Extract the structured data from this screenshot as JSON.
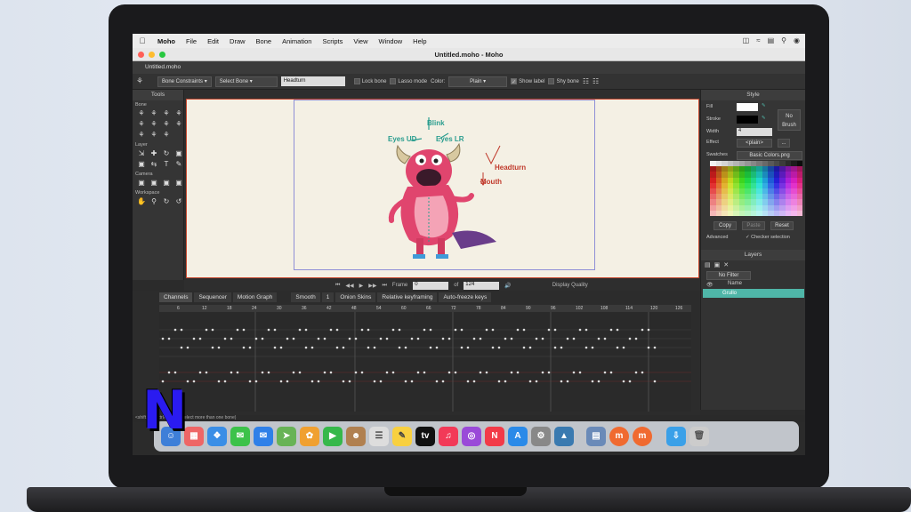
{
  "menu": {
    "app_name": "Moho",
    "items": [
      "File",
      "Edit",
      "Draw",
      "Bone",
      "Animation",
      "Scripts",
      "View",
      "Window",
      "Help"
    ]
  },
  "window": {
    "title": "Untitled.moho - Moho",
    "doc_tab": "Untitled.moho"
  },
  "toolbar": {
    "bone_constraints": "Bone Constraints",
    "select_bone": "Select Bone",
    "bone_name": "Headturn",
    "lock_bone": "Lock bone",
    "lasso_mode": "Lasso mode",
    "color_label": "Color:",
    "color_value": "Plain",
    "show_label": "Show label",
    "shy_bone": "Shy bone"
  },
  "tools": {
    "title": "Tools",
    "sections": [
      "Bone",
      "Layer",
      "Camera",
      "Workspace"
    ]
  },
  "bone_labels": {
    "blink": "Blink",
    "eyes_ud": "Eyes UD",
    "eyes_lr": "Eyes LR",
    "headturn": "Headturn",
    "mouth": "Mouth"
  },
  "style": {
    "title": "Style",
    "fill": "Fill",
    "stroke": "Stroke",
    "width_label": "Width",
    "width_value": "4",
    "effect_label": "Effect",
    "effect_value": "<plain>",
    "no_brush": "No Brush",
    "swatches_label": "Swatches",
    "swatches_value": "Basic Colors.png",
    "copy": "Copy",
    "paste": "Paste",
    "reset": "Reset",
    "advanced": "Advanced",
    "checker": "Checker selection"
  },
  "layers": {
    "title": "Layers",
    "filter": "No Filter",
    "name_col": "Name",
    "layer_name": "Grullo"
  },
  "transport": {
    "frame_label": "Frame",
    "frame_value": "0",
    "of_label": "of",
    "total_frames": "124",
    "display_quality": "Display Quality"
  },
  "timeline": {
    "tabs": [
      "Channels",
      "Sequencer",
      "Motion Graph"
    ],
    "interp": "Smooth",
    "interp_num": "1",
    "onion": "Onion Skins",
    "relative": "Relative keyframing",
    "autofreeze": "Auto-freeze keys",
    "ruler": [
      "6",
      "12",
      "18",
      "24",
      "30",
      "36",
      "42",
      "48",
      "54",
      "60",
      "66",
      "72",
      "78",
      "84",
      "90",
      "96",
      "102",
      "108",
      "114",
      "120",
      "126"
    ]
  },
  "status": {
    "text": "<shift> or <ctrl/cmd> to select more than one bone)"
  },
  "overlay": {
    "logo_letter": "N"
  },
  "colors": {
    "selected_layer": "#4fb6a8",
    "stage_border": "#c8482e",
    "frame_border": "#8f8fd6",
    "bone_label": "#2a9d8f",
    "bone_red": "#c0392b"
  }
}
